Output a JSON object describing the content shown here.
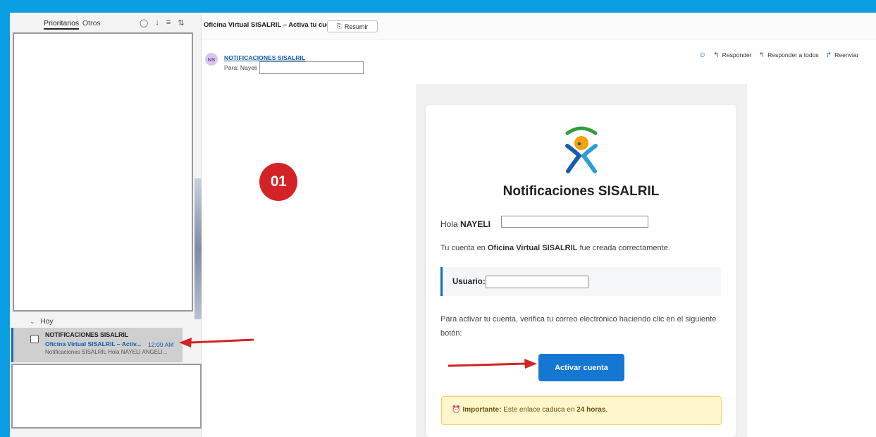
{
  "list_pane": {
    "tabs": [
      "Prioritarios",
      "Otros"
    ],
    "icons": [
      "filter-circle-icon",
      "download-icon",
      "filter-icon",
      "sort-icon"
    ],
    "icon_glyphs": [
      "◯",
      "↓",
      "≡",
      "⇅"
    ],
    "group_label": "Hoy",
    "selected_item": {
      "sender": "NOTIFICACIONES SISALRIL",
      "subject": "Oficina Virtual SISALRIL – Activ...",
      "time": "12:09 AM",
      "preview": "Notificaciones SISALRIL Hola NAYELI ANGELI..."
    }
  },
  "reading_pane": {
    "subject": "Oficina Virtual SISALRIL – Activa tu cuenta",
    "summarize_button": "Resumir",
    "sender_initials": "NS",
    "sender_name": "NOTIFICACIONES SISALRIL",
    "to_line": "Para: Nayeli",
    "actions": {
      "reply": "Responder",
      "reply_all": "Responder a todos",
      "forward": "Reenviar"
    }
  },
  "email": {
    "brand_title": "Notificaciones SISALRIL",
    "greeting_prefix": "Hola ",
    "greeting_name": "NAYELI",
    "created_prefix": "Tu cuenta en ",
    "created_strong": "Oficina Virtual SISALRIL",
    "created_suffix": " fue creada correctamente.",
    "user_label": "Usuario:",
    "activate_instructions": "Para activar tu cuenta, verifica tu correo electrónico haciendo clic en el siguiente botón:",
    "activate_button": "Activar cuenta",
    "warning_strong": "Importante:",
    "warning_text": " Este enlace caduca en ",
    "warning_hours": "24 horas",
    "warning_end": "."
  },
  "overlay": {
    "step_label": "01"
  },
  "colors": {
    "frame": "#0b9ee3",
    "accent": "#0f6cbd",
    "button": "#1677d2",
    "annotation": "#d32326"
  }
}
